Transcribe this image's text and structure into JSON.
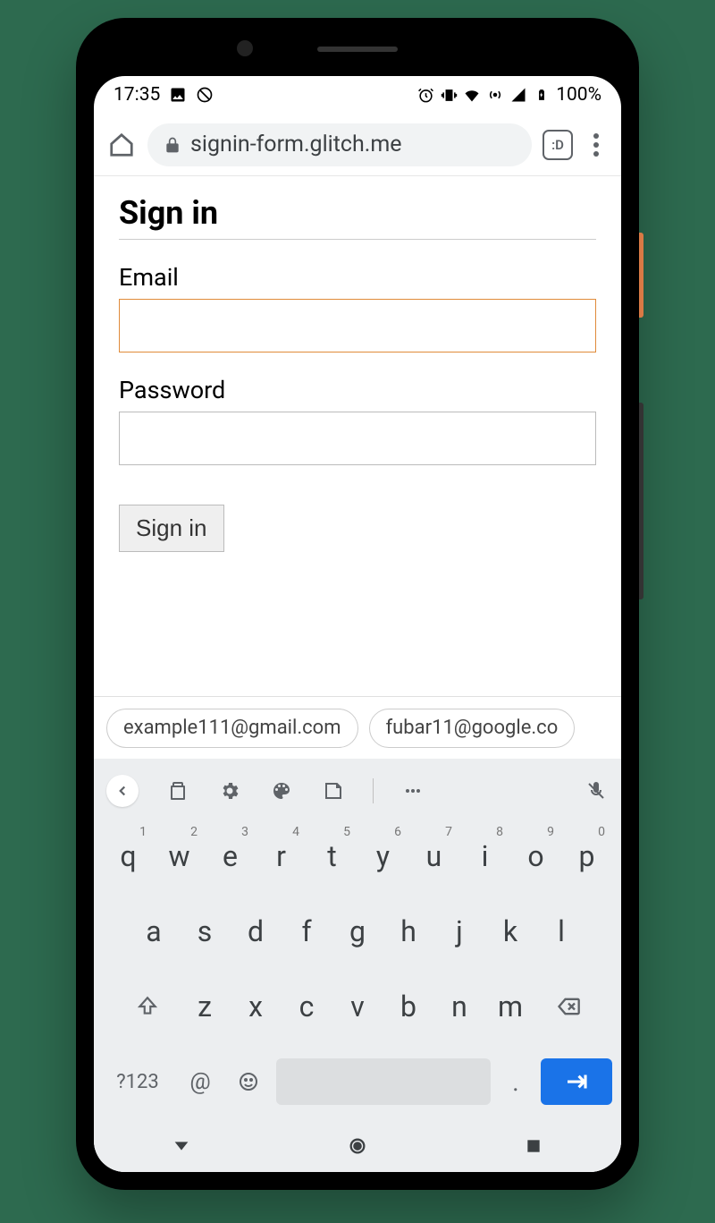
{
  "status": {
    "time": "17:35",
    "battery": "100%"
  },
  "browser": {
    "url": "signin-form.glitch.me",
    "tabs_label": ":D"
  },
  "page": {
    "title": "Sign in",
    "email_label": "Email",
    "email_value": "",
    "password_label": "Password",
    "password_value": "",
    "submit_label": "Sign in"
  },
  "suggestions": [
    "example111@gmail.com",
    "fubar11@google.co"
  ],
  "keyboard": {
    "row1": [
      {
        "k": "q",
        "s": "1"
      },
      {
        "k": "w",
        "s": "2"
      },
      {
        "k": "e",
        "s": "3"
      },
      {
        "k": "r",
        "s": "4"
      },
      {
        "k": "t",
        "s": "5"
      },
      {
        "k": "y",
        "s": "6"
      },
      {
        "k": "u",
        "s": "7"
      },
      {
        "k": "i",
        "s": "8"
      },
      {
        "k": "o",
        "s": "9"
      },
      {
        "k": "p",
        "s": "0"
      }
    ],
    "row2": [
      "a",
      "s",
      "d",
      "f",
      "g",
      "h",
      "j",
      "k",
      "l"
    ],
    "row3": [
      "z",
      "x",
      "c",
      "v",
      "b",
      "n",
      "m"
    ],
    "sym_label": "?123",
    "at_label": "@",
    "period_label": "."
  }
}
